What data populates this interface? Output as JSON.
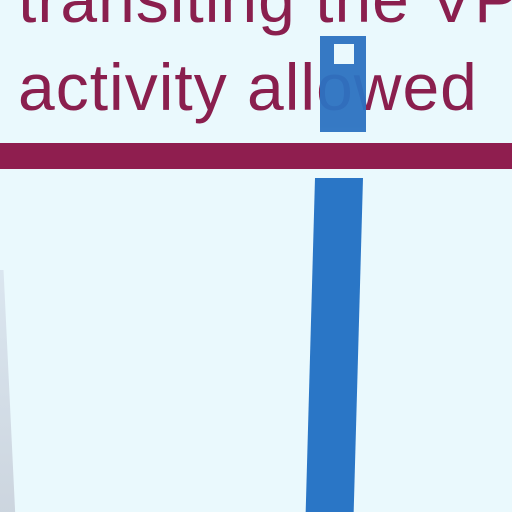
{
  "heading": {
    "line_1": "transiting the VP",
    "line_2": "activity allowed"
  },
  "colors": {
    "background": "#eaf9fd",
    "text": "#8a1f4e",
    "divider": "#8f1e4f",
    "accent_blue": "#2a76c6"
  }
}
